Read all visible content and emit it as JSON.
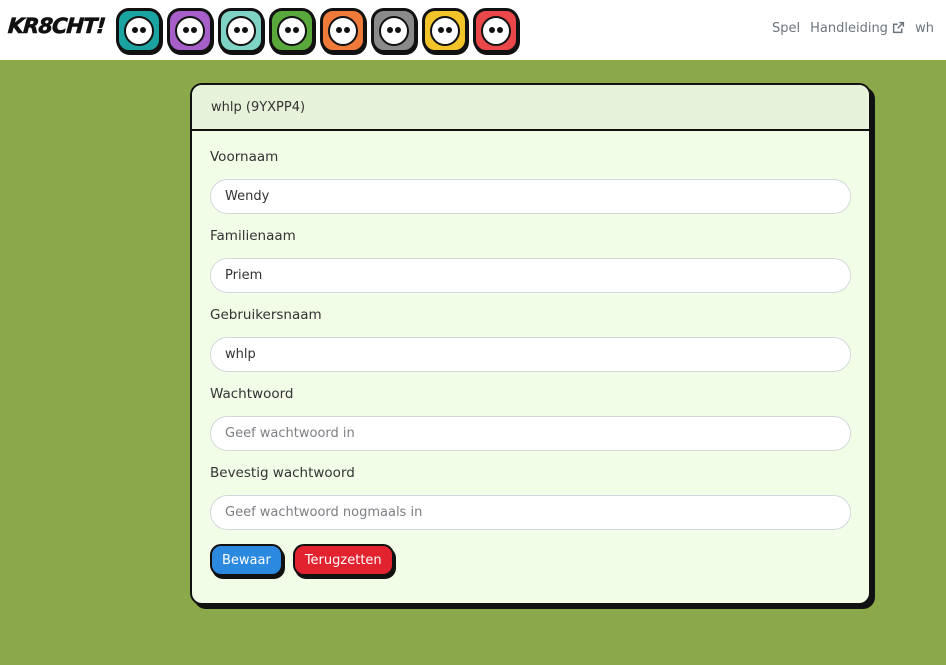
{
  "brand": {
    "logo_text": "KR8CHT!"
  },
  "avatars": [
    {
      "name": "avatar-teal",
      "color": "#1aa3a0"
    },
    {
      "name": "avatar-purple",
      "color": "#a65ec8"
    },
    {
      "name": "avatar-mint",
      "color": "#7fd3c4"
    },
    {
      "name": "avatar-green",
      "color": "#5aa83c"
    },
    {
      "name": "avatar-orange",
      "color": "#f07a3a"
    },
    {
      "name": "avatar-grey",
      "color": "#8a8a8a"
    },
    {
      "name": "avatar-yellow",
      "color": "#f2c42a"
    },
    {
      "name": "avatar-red",
      "color": "#e9474a"
    }
  ],
  "nav": {
    "game_label": "Spel",
    "manual_label": "Handleiding",
    "user_label": "wh"
  },
  "card": {
    "header": "whlp (9YXPP4)",
    "fields": {
      "first_name": {
        "label": "Voornaam",
        "value": "Wendy"
      },
      "last_name": {
        "label": "Familienaam",
        "value": "Priem"
      },
      "username": {
        "label": "Gebruikersnaam",
        "value": "whlp"
      },
      "password": {
        "label": "Wachtwoord",
        "placeholder": "Geef wachtwoord in"
      },
      "confirm_password": {
        "label": "Bevestig wachtwoord",
        "placeholder": "Geef wachtwoord nogmaals in"
      }
    },
    "buttons": {
      "save": "Bewaar",
      "reset": "Terugzetten"
    }
  },
  "colors": {
    "page_background": "#8ba84a",
    "card_background": "#f1fde6",
    "save_button": "#2b89e0",
    "reset_button": "#e2232f"
  }
}
